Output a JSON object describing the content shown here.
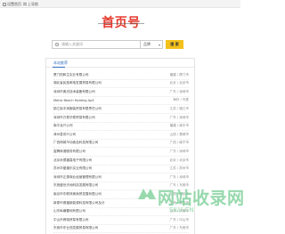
{
  "topbar": {
    "home_label": "设置首页",
    "nav_label": "上导航"
  },
  "logo": {
    "text": "首页号"
  },
  "search": {
    "placeholder": "请输入关键词",
    "select_value": "品牌",
    "button_label": "搜 索"
  },
  "list": {
    "heading": "本站推荐",
    "items": [
      {
        "name": "厦门恒和生实业有限公司",
        "loc": "福建 / 厦门市"
      },
      {
        "name": "湖北省民族邮电发展贸易有限公司",
        "loc": "北京 / 北京市"
      },
      {
        "name": "深圳市奥光技术装备有限公司",
        "loc": "广东 / 深圳市"
      },
      {
        "name": "Metro Beach Holding ApS",
        "loc": "海外 / 丹麦"
      },
      {
        "name": "镇江裕丰润服装贸易有限责任公司",
        "loc": "江苏 / 镇江市"
      },
      {
        "name": "深圳市万泰华泰贸易有限公司",
        "loc": "广东 / 深圳市"
      },
      {
        "name": "南平龙兴公司",
        "loc": "福建 / 南平市"
      },
      {
        "name": "泽州县伟兴公司",
        "loc": "山西 / 晋城市"
      },
      {
        "name": "广西明城不动食品科技有限公司",
        "loc": "广西 / 南宁市"
      },
      {
        "name": "富腾商港服务有限公司",
        "loc": "广东 / 深圳市"
      },
      {
        "name": "北京永德福嘉电子有限公司",
        "loc": "北京 / 北京市"
      },
      {
        "name": "苏州华盛福乐实业有限公司",
        "loc": "江苏 / 苏州市"
      },
      {
        "name": "深圳市正源商业经营管理有限公司",
        "loc": "广东 / 深圳市"
      },
      {
        "name": "东莞盛世天地科技发展有限公司",
        "loc": "广东 / 东莞市"
      },
      {
        "name": "南京市东联林美商贸发展有限公司",
        "loc": "江苏 / 南京市"
      },
      {
        "name": "新泰市德福新能源科技有限公司及分",
        "loc": "山东 / 泰安市"
      },
      {
        "name": "山东纵横置地有限公司",
        "loc": "山东 / 济南市"
      },
      {
        "name": "中山市睿瑞贸易有限公司",
        "loc": "广东 / 中山市"
      },
      {
        "name": "东莞市东仕恒发展贸易有限公司",
        "loc": "广东 / 东莞市"
      }
    ]
  },
  "watermark": {
    "text": "网站收录网",
    "url": "SILU.CN"
  }
}
